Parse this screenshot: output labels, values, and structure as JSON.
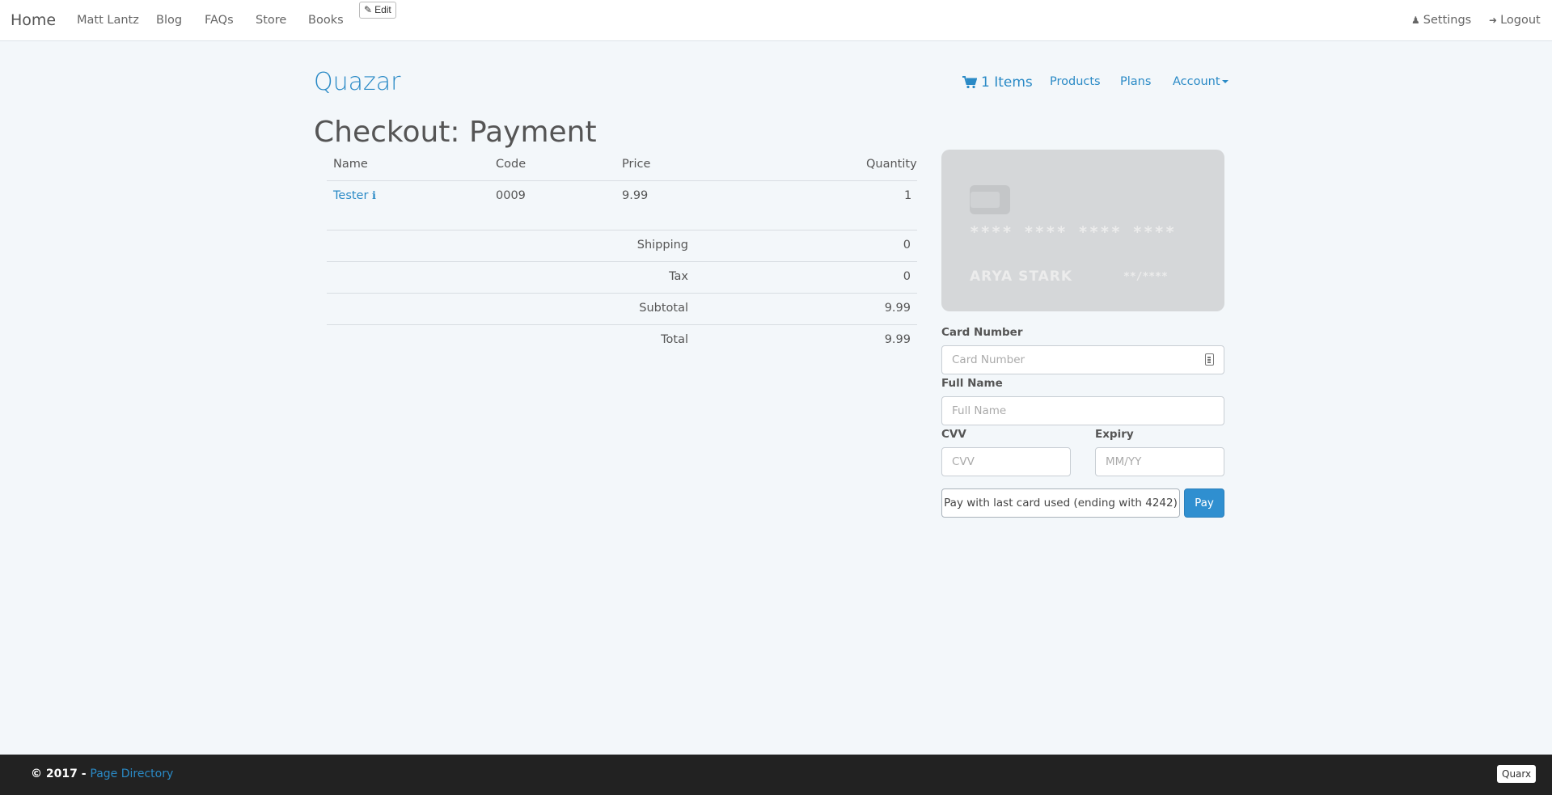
{
  "topnav": {
    "brand": "Home",
    "links": [
      "Matt Lantz",
      "Blog",
      "FAQs",
      "Store",
      "Books"
    ],
    "edit_label": "Edit",
    "settings_label": "Settings",
    "logout_label": "Logout"
  },
  "store": {
    "title": "Quazar",
    "cart_label": "1 Items",
    "products_label": "Products",
    "plans_label": "Plans",
    "account_label": "Account"
  },
  "page_title": "Checkout: Payment",
  "table": {
    "headers": {
      "name": "Name",
      "code": "Code",
      "price": "Price",
      "quantity": "Quantity"
    },
    "rows": [
      {
        "name": "Tester",
        "code": "0009",
        "price": "9.99",
        "quantity": "1"
      }
    ],
    "summary": [
      {
        "label": "Shipping",
        "value": "0"
      },
      {
        "label": "Tax",
        "value": "0"
      },
      {
        "label": "Subtotal",
        "value": "9.99"
      },
      {
        "label": "Total",
        "value": "9.99"
      }
    ]
  },
  "card_preview": {
    "number": "**** **** **** ****",
    "holder": "ARYA STARK",
    "expiry": "**/****"
  },
  "form": {
    "card_number_label": "Card Number",
    "card_number_placeholder": "Card Number",
    "full_name_label": "Full Name",
    "full_name_placeholder": "Full Name",
    "cvv_label": "CVV",
    "cvv_placeholder": "CVV",
    "expiry_label": "Expiry",
    "expiry_placeholder": "MM/YY",
    "last_card_button": "Pay with last card used (ending with 4242)",
    "pay_button": "Pay"
  },
  "footer": {
    "copyright": "© 2017 -",
    "link_label": "Page Directory",
    "badge": "Quarx"
  }
}
